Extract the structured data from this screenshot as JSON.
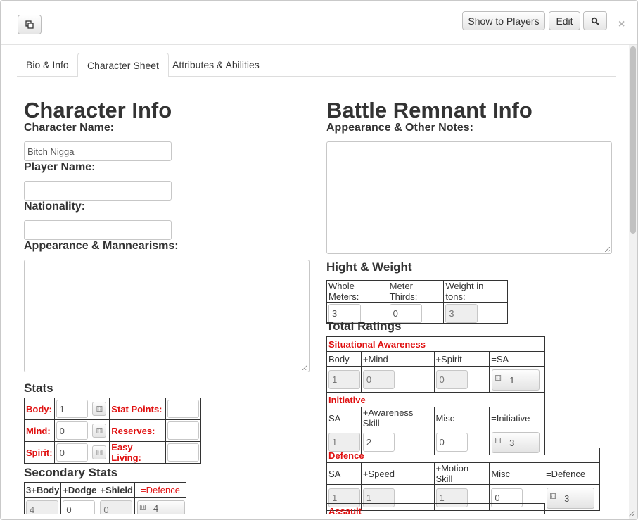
{
  "toolbar": {
    "popout_icon": "popout-icon",
    "show_to_players": "Show to Players",
    "edit": "Edit",
    "search_icon": "search-icon",
    "close": "×"
  },
  "tabs": [
    {
      "label": "Bio & Info"
    },
    {
      "label": "Character Sheet"
    },
    {
      "label": "Attributes & Abilities"
    }
  ],
  "character_info": {
    "heading": "Character Info",
    "character_name_label": "Character Name:",
    "character_name_value": "Bitch Nigga",
    "player_name_label": "Player Name:",
    "player_name_value": "",
    "nationality_label": "Nationality:",
    "nationality_value": "",
    "appearance_label": "Appearance & Mannearisms:"
  },
  "stats": {
    "heading": "Stats",
    "rows": [
      {
        "label": "Body:",
        "value": "1",
        "right_label": "Stat Points:",
        "right_value": ""
      },
      {
        "label": "Mind:",
        "value": "0",
        "right_label": "Reserves:",
        "right_value": ""
      },
      {
        "label": "Spirit:",
        "value": "0",
        "right_label": "Easy Living:",
        "right_value": ""
      }
    ]
  },
  "secondary_stats": {
    "heading": "Secondary Stats",
    "headers": [
      "3+Body",
      "+Dodge",
      "+Shield",
      "=Defence"
    ],
    "values": [
      "4",
      "0",
      "0",
      "4"
    ]
  },
  "battle_remnant": {
    "heading": "Battle Remnant Info",
    "appearance_label": "Appearance & Other Notes:",
    "hw_heading": "Hight & Weight",
    "hw_headers": [
      "Whole Meters:",
      "Meter Thirds:",
      "Weight in tons:"
    ],
    "hw_values": [
      "3",
      "0",
      "3"
    ]
  },
  "total_ratings": {
    "heading": "Total Ratings",
    "sa": {
      "title": "Situational Awareness",
      "headers": [
        "Body",
        "+Mind",
        "+Spirit",
        "=SA"
      ],
      "values": [
        "1",
        "0",
        "0",
        "1"
      ]
    },
    "initiative": {
      "title": "Initiative",
      "headers": [
        "SA",
        "+Awareness Skill",
        "Misc",
        "=Initiative"
      ],
      "values": [
        "1",
        "2",
        "0",
        "3"
      ]
    },
    "defence": {
      "title": "Defence",
      "headers": [
        "SA",
        "+Speed",
        "+Motion Skill",
        "Misc",
        "=Defence"
      ],
      "values": [
        "1",
        "1",
        "1",
        "0",
        "3"
      ]
    },
    "assault": {
      "title": "Assault"
    }
  },
  "icons": {
    "dice": "dice-icon"
  }
}
